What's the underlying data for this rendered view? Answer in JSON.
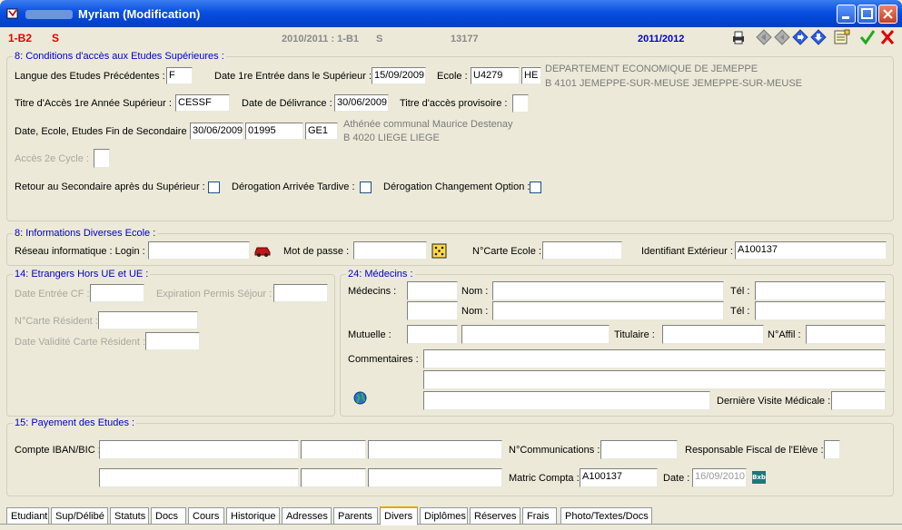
{
  "window": {
    "title": "Myriam (Modification)"
  },
  "header": {
    "code": "1-B2",
    "code_s": "S",
    "prev_year": "2010/2011 : 1-B1",
    "prev_s": "S",
    "number": "13177",
    "year": "2011/2012"
  },
  "acces": {
    "legend": "8: Conditions d'accès aux Etudes Supérieures :",
    "langue_label": "Langue des Etudes Précédentes :",
    "langue_value": "F",
    "date_entree_label": "Date 1re Entrée dans le Supérieur :",
    "date_entree_value": "15/09/2009",
    "ecole_label": "Ecole :",
    "ecole_code": "U4279",
    "ecole_type": "HE",
    "ecole_name": "DEPARTEMENT ECONOMIQUE DE JEMEPPE",
    "ecole_address": "B  4101  JEMEPPE-SUR-MEUSE  JEMEPPE-SUR-MEUSE",
    "titre_label": "Titre d'Accès 1re Année Supérieur :",
    "titre_value": "CESSF",
    "date_delivrance_label": "Date de Délivrance :",
    "date_delivrance_value": "30/06/2009",
    "titre_provisoire_label": "Titre d'accès provisoire :",
    "fin_secondaire_label": "Date, Ecole, Etudes Fin de Secondaire :",
    "fin_date": "30/06/2009",
    "fin_ecole": "01995",
    "fin_etudes": "GE1",
    "fin_ecole_name": "Athénée communal Maurice Destenay",
    "fin_ecole_address": "B  4020  LIEGE  LIEGE",
    "acces_2e_cycle_label": "Accès 2e Cycle :",
    "retour_label": "Retour au Secondaire après du Supérieur :",
    "derogation_arrivee_label": "Dérogation Arrivée Tardive :",
    "derogation_option_label": "Dérogation Changement Option :"
  },
  "infos": {
    "legend": "8: Informations Diverses Ecole :",
    "login_label": "Réseau informatique : Login :",
    "login_value": "",
    "password_label": "Mot de passe :",
    "password_value": "",
    "carte_ecole_label": "N°Carte Ecole :",
    "carte_ecole_value": "",
    "identifiant_label": "Identifiant Extérieur :",
    "identifiant_value": "A100137"
  },
  "etrangers": {
    "legend": "14: Etrangers Hors UE et UE :",
    "date_entree_cf_label": "Date Entrée CF :",
    "expiration_label": "Expiration Permis Séjour :",
    "carte_resident_label": "N°Carte Résident :",
    "validite_label": "Date Validité Carte Résident :"
  },
  "medecins": {
    "legend": "24: Médecins :",
    "medecins_label": "Médecins :",
    "nom_label": "Nom :",
    "tel_label": "Tél :",
    "mutuelle_label": "Mutuelle :",
    "titulaire_label": "Titulaire :",
    "naffil_label": "N°Affil :",
    "commentaires_label": "Commentaires :",
    "derniere_visite_label": "Dernière Visite Médicale :"
  },
  "payement": {
    "legend": "15: Payement des Etudes :",
    "iban_label": "Compte IBAN/BIC :",
    "communications_label": "N°Communications :",
    "responsable_label": "Responsable Fiscal de l'Elève :",
    "matric_label": "Matric Compta :",
    "matric_value": "A100137",
    "date_label": "Date :",
    "date_value": "16/09/2010",
    "bxb_label": "Bxb"
  },
  "tabs": [
    {
      "label": "Etudiant"
    },
    {
      "label": "Sup/Délibé"
    },
    {
      "label": "Statuts"
    },
    {
      "label": "Docs"
    },
    {
      "label": "Cours"
    },
    {
      "label": "Historique"
    },
    {
      "label": "Adresses"
    },
    {
      "label": "Parents"
    },
    {
      "label": "Divers"
    },
    {
      "label": "Diplômes"
    },
    {
      "label": "Réserves"
    },
    {
      "label": "Frais"
    },
    {
      "label": "Photo/Textes/Docs"
    }
  ],
  "colors": {
    "accent_blue": "#0000c8",
    "header_red": "#e00000",
    "titlebar": "#0a4fe0"
  },
  "icons": {
    "toolbar": [
      "print-icon",
      "first-record-icon",
      "previous-record-icon",
      "next-record-icon",
      "last-record-icon",
      "list-icon",
      "validate-check-icon",
      "cancel-x-icon"
    ]
  }
}
